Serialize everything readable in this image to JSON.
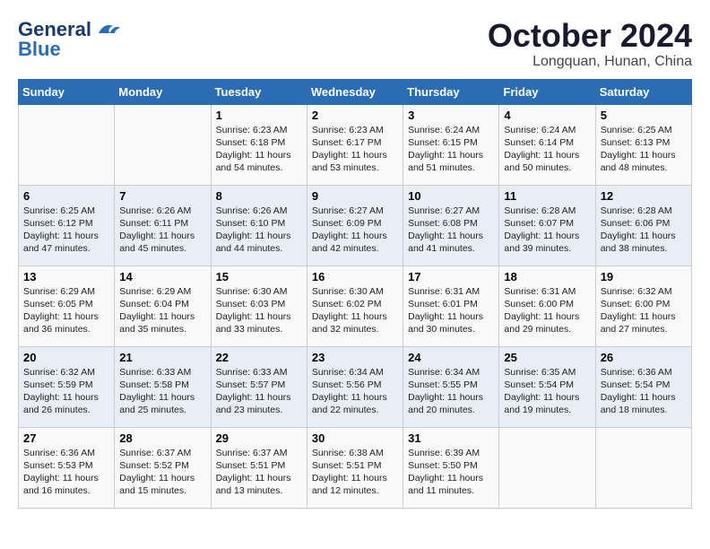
{
  "header": {
    "logo_general": "General",
    "logo_blue": "Blue",
    "month_title": "October 2024",
    "location": "Longquan, Hunan, China"
  },
  "days_of_week": [
    "Sunday",
    "Monday",
    "Tuesday",
    "Wednesday",
    "Thursday",
    "Friday",
    "Saturday"
  ],
  "weeks": [
    [
      {
        "day": null,
        "info": null
      },
      {
        "day": null,
        "info": null
      },
      {
        "day": "1",
        "info": "Sunrise: 6:23 AM\nSunset: 6:18 PM\nDaylight: 11 hours and 54 minutes."
      },
      {
        "day": "2",
        "info": "Sunrise: 6:23 AM\nSunset: 6:17 PM\nDaylight: 11 hours and 53 minutes."
      },
      {
        "day": "3",
        "info": "Sunrise: 6:24 AM\nSunset: 6:15 PM\nDaylight: 11 hours and 51 minutes."
      },
      {
        "day": "4",
        "info": "Sunrise: 6:24 AM\nSunset: 6:14 PM\nDaylight: 11 hours and 50 minutes."
      },
      {
        "day": "5",
        "info": "Sunrise: 6:25 AM\nSunset: 6:13 PM\nDaylight: 11 hours and 48 minutes."
      }
    ],
    [
      {
        "day": "6",
        "info": "Sunrise: 6:25 AM\nSunset: 6:12 PM\nDaylight: 11 hours and 47 minutes."
      },
      {
        "day": "7",
        "info": "Sunrise: 6:26 AM\nSunset: 6:11 PM\nDaylight: 11 hours and 45 minutes."
      },
      {
        "day": "8",
        "info": "Sunrise: 6:26 AM\nSunset: 6:10 PM\nDaylight: 11 hours and 44 minutes."
      },
      {
        "day": "9",
        "info": "Sunrise: 6:27 AM\nSunset: 6:09 PM\nDaylight: 11 hours and 42 minutes."
      },
      {
        "day": "10",
        "info": "Sunrise: 6:27 AM\nSunset: 6:08 PM\nDaylight: 11 hours and 41 minutes."
      },
      {
        "day": "11",
        "info": "Sunrise: 6:28 AM\nSunset: 6:07 PM\nDaylight: 11 hours and 39 minutes."
      },
      {
        "day": "12",
        "info": "Sunrise: 6:28 AM\nSunset: 6:06 PM\nDaylight: 11 hours and 38 minutes."
      }
    ],
    [
      {
        "day": "13",
        "info": "Sunrise: 6:29 AM\nSunset: 6:05 PM\nDaylight: 11 hours and 36 minutes."
      },
      {
        "day": "14",
        "info": "Sunrise: 6:29 AM\nSunset: 6:04 PM\nDaylight: 11 hours and 35 minutes."
      },
      {
        "day": "15",
        "info": "Sunrise: 6:30 AM\nSunset: 6:03 PM\nDaylight: 11 hours and 33 minutes."
      },
      {
        "day": "16",
        "info": "Sunrise: 6:30 AM\nSunset: 6:02 PM\nDaylight: 11 hours and 32 minutes."
      },
      {
        "day": "17",
        "info": "Sunrise: 6:31 AM\nSunset: 6:01 PM\nDaylight: 11 hours and 30 minutes."
      },
      {
        "day": "18",
        "info": "Sunrise: 6:31 AM\nSunset: 6:00 PM\nDaylight: 11 hours and 29 minutes."
      },
      {
        "day": "19",
        "info": "Sunrise: 6:32 AM\nSunset: 6:00 PM\nDaylight: 11 hours and 27 minutes."
      }
    ],
    [
      {
        "day": "20",
        "info": "Sunrise: 6:32 AM\nSunset: 5:59 PM\nDaylight: 11 hours and 26 minutes."
      },
      {
        "day": "21",
        "info": "Sunrise: 6:33 AM\nSunset: 5:58 PM\nDaylight: 11 hours and 25 minutes."
      },
      {
        "day": "22",
        "info": "Sunrise: 6:33 AM\nSunset: 5:57 PM\nDaylight: 11 hours and 23 minutes."
      },
      {
        "day": "23",
        "info": "Sunrise: 6:34 AM\nSunset: 5:56 PM\nDaylight: 11 hours and 22 minutes."
      },
      {
        "day": "24",
        "info": "Sunrise: 6:34 AM\nSunset: 5:55 PM\nDaylight: 11 hours and 20 minutes."
      },
      {
        "day": "25",
        "info": "Sunrise: 6:35 AM\nSunset: 5:54 PM\nDaylight: 11 hours and 19 minutes."
      },
      {
        "day": "26",
        "info": "Sunrise: 6:36 AM\nSunset: 5:54 PM\nDaylight: 11 hours and 18 minutes."
      }
    ],
    [
      {
        "day": "27",
        "info": "Sunrise: 6:36 AM\nSunset: 5:53 PM\nDaylight: 11 hours and 16 minutes."
      },
      {
        "day": "28",
        "info": "Sunrise: 6:37 AM\nSunset: 5:52 PM\nDaylight: 11 hours and 15 minutes."
      },
      {
        "day": "29",
        "info": "Sunrise: 6:37 AM\nSunset: 5:51 PM\nDaylight: 11 hours and 13 minutes."
      },
      {
        "day": "30",
        "info": "Sunrise: 6:38 AM\nSunset: 5:51 PM\nDaylight: 11 hours and 12 minutes."
      },
      {
        "day": "31",
        "info": "Sunrise: 6:39 AM\nSunset: 5:50 PM\nDaylight: 11 hours and 11 minutes."
      },
      {
        "day": null,
        "info": null
      },
      {
        "day": null,
        "info": null
      }
    ]
  ]
}
